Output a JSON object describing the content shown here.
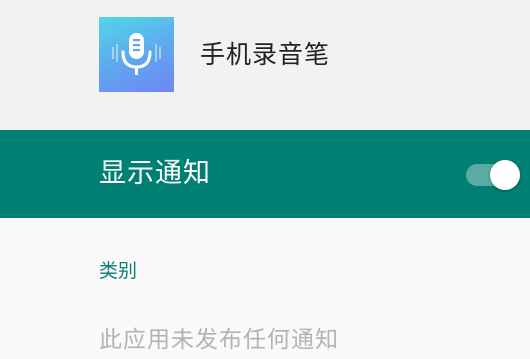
{
  "app": {
    "name": "手机录音笔",
    "icon": "microphone-icon"
  },
  "notifications": {
    "show_label": "显示通知",
    "enabled": true
  },
  "section": {
    "category_label": "类别",
    "empty_message": "此应用未发布任何通知"
  },
  "colors": {
    "accent": "#008072",
    "category_text": "#0a7f73",
    "muted_text": "#b3b3b3"
  }
}
